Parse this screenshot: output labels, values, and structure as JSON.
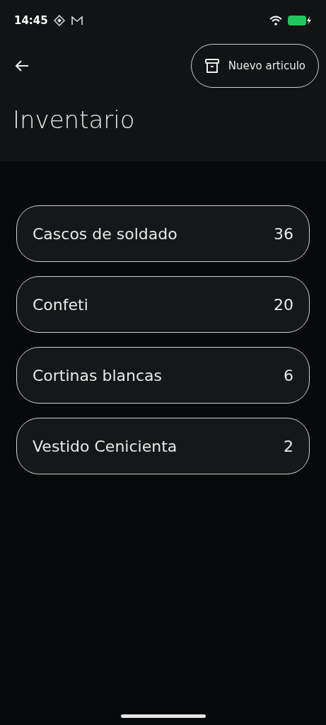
{
  "status_bar": {
    "time": "14:45"
  },
  "header": {
    "button": "Nuevo articulo",
    "title": "Inventario"
  },
  "items": [
    {
      "name": "Cascos de soldado",
      "count": "36"
    },
    {
      "name": "Confeti",
      "count": "20"
    },
    {
      "name": "Cortinas blancas",
      "count": "6"
    },
    {
      "name": "Vestido Cenicienta",
      "count": "2"
    }
  ]
}
